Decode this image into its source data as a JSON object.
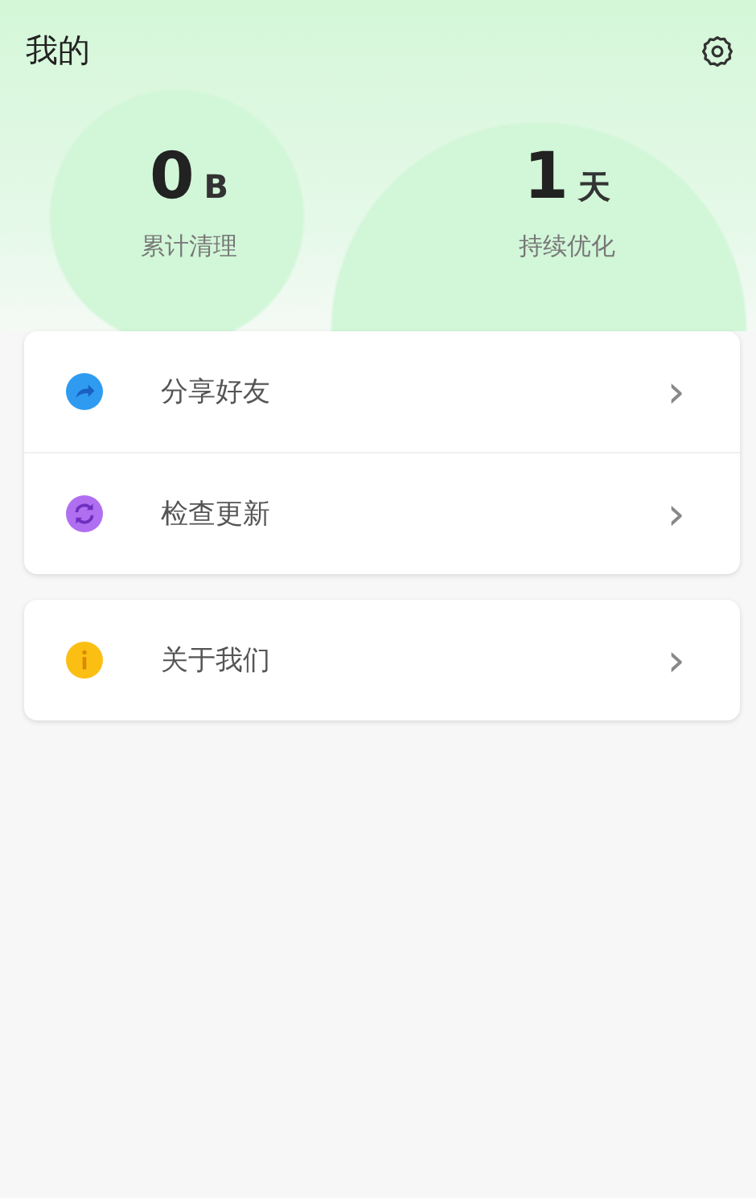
{
  "header": {
    "title": "我的"
  },
  "stats": [
    {
      "value": "0",
      "unit": "B",
      "label": "累计清理"
    },
    {
      "value": "1",
      "unit": "天",
      "label": "持续优化"
    }
  ],
  "groups": [
    {
      "items": [
        {
          "kind": "share",
          "label": "分享好友",
          "chevron": "›"
        },
        {
          "kind": "update",
          "label": "检查更新",
          "chevron": "›"
        }
      ]
    },
    {
      "items": [
        {
          "kind": "info",
          "label": "关于我们",
          "chevron": "›"
        }
      ]
    }
  ]
}
